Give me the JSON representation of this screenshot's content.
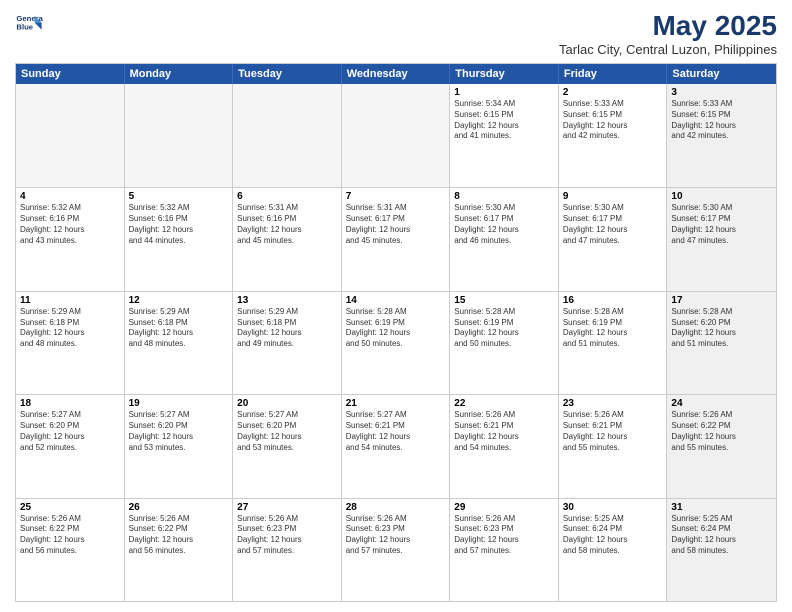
{
  "logo": {
    "line1": "General",
    "line2": "Blue"
  },
  "title": "May 2025",
  "location": "Tarlac City, Central Luzon, Philippines",
  "days": [
    "Sunday",
    "Monday",
    "Tuesday",
    "Wednesday",
    "Thursday",
    "Friday",
    "Saturday"
  ],
  "weeks": [
    [
      {
        "day": "",
        "info": "",
        "empty": true
      },
      {
        "day": "",
        "info": "",
        "empty": true
      },
      {
        "day": "",
        "info": "",
        "empty": true
      },
      {
        "day": "",
        "info": "",
        "empty": true
      },
      {
        "day": "1",
        "info": "Sunrise: 5:34 AM\nSunset: 6:15 PM\nDaylight: 12 hours\nand 41 minutes."
      },
      {
        "day": "2",
        "info": "Sunrise: 5:33 AM\nSunset: 6:15 PM\nDaylight: 12 hours\nand 42 minutes."
      },
      {
        "day": "3",
        "info": "Sunrise: 5:33 AM\nSunset: 6:15 PM\nDaylight: 12 hours\nand 42 minutes.",
        "shaded": true
      }
    ],
    [
      {
        "day": "4",
        "info": "Sunrise: 5:32 AM\nSunset: 6:16 PM\nDaylight: 12 hours\nand 43 minutes."
      },
      {
        "day": "5",
        "info": "Sunrise: 5:32 AM\nSunset: 6:16 PM\nDaylight: 12 hours\nand 44 minutes."
      },
      {
        "day": "6",
        "info": "Sunrise: 5:31 AM\nSunset: 6:16 PM\nDaylight: 12 hours\nand 45 minutes."
      },
      {
        "day": "7",
        "info": "Sunrise: 5:31 AM\nSunset: 6:17 PM\nDaylight: 12 hours\nand 45 minutes."
      },
      {
        "day": "8",
        "info": "Sunrise: 5:30 AM\nSunset: 6:17 PM\nDaylight: 12 hours\nand 46 minutes."
      },
      {
        "day": "9",
        "info": "Sunrise: 5:30 AM\nSunset: 6:17 PM\nDaylight: 12 hours\nand 47 minutes."
      },
      {
        "day": "10",
        "info": "Sunrise: 5:30 AM\nSunset: 6:17 PM\nDaylight: 12 hours\nand 47 minutes.",
        "shaded": true
      }
    ],
    [
      {
        "day": "11",
        "info": "Sunrise: 5:29 AM\nSunset: 6:18 PM\nDaylight: 12 hours\nand 48 minutes."
      },
      {
        "day": "12",
        "info": "Sunrise: 5:29 AM\nSunset: 6:18 PM\nDaylight: 12 hours\nand 48 minutes."
      },
      {
        "day": "13",
        "info": "Sunrise: 5:29 AM\nSunset: 6:18 PM\nDaylight: 12 hours\nand 49 minutes."
      },
      {
        "day": "14",
        "info": "Sunrise: 5:28 AM\nSunset: 6:19 PM\nDaylight: 12 hours\nand 50 minutes."
      },
      {
        "day": "15",
        "info": "Sunrise: 5:28 AM\nSunset: 6:19 PM\nDaylight: 12 hours\nand 50 minutes."
      },
      {
        "day": "16",
        "info": "Sunrise: 5:28 AM\nSunset: 6:19 PM\nDaylight: 12 hours\nand 51 minutes."
      },
      {
        "day": "17",
        "info": "Sunrise: 5:28 AM\nSunset: 6:20 PM\nDaylight: 12 hours\nand 51 minutes.",
        "shaded": true
      }
    ],
    [
      {
        "day": "18",
        "info": "Sunrise: 5:27 AM\nSunset: 6:20 PM\nDaylight: 12 hours\nand 52 minutes."
      },
      {
        "day": "19",
        "info": "Sunrise: 5:27 AM\nSunset: 6:20 PM\nDaylight: 12 hours\nand 53 minutes."
      },
      {
        "day": "20",
        "info": "Sunrise: 5:27 AM\nSunset: 6:20 PM\nDaylight: 12 hours\nand 53 minutes."
      },
      {
        "day": "21",
        "info": "Sunrise: 5:27 AM\nSunset: 6:21 PM\nDaylight: 12 hours\nand 54 minutes."
      },
      {
        "day": "22",
        "info": "Sunrise: 5:26 AM\nSunset: 6:21 PM\nDaylight: 12 hours\nand 54 minutes."
      },
      {
        "day": "23",
        "info": "Sunrise: 5:26 AM\nSunset: 6:21 PM\nDaylight: 12 hours\nand 55 minutes."
      },
      {
        "day": "24",
        "info": "Sunrise: 5:26 AM\nSunset: 6:22 PM\nDaylight: 12 hours\nand 55 minutes.",
        "shaded": true
      }
    ],
    [
      {
        "day": "25",
        "info": "Sunrise: 5:26 AM\nSunset: 6:22 PM\nDaylight: 12 hours\nand 56 minutes."
      },
      {
        "day": "26",
        "info": "Sunrise: 5:26 AM\nSunset: 6:22 PM\nDaylight: 12 hours\nand 56 minutes."
      },
      {
        "day": "27",
        "info": "Sunrise: 5:26 AM\nSunset: 6:23 PM\nDaylight: 12 hours\nand 57 minutes."
      },
      {
        "day": "28",
        "info": "Sunrise: 5:26 AM\nSunset: 6:23 PM\nDaylight: 12 hours\nand 57 minutes."
      },
      {
        "day": "29",
        "info": "Sunrise: 5:26 AM\nSunset: 6:23 PM\nDaylight: 12 hours\nand 57 minutes."
      },
      {
        "day": "30",
        "info": "Sunrise: 5:25 AM\nSunset: 6:24 PM\nDaylight: 12 hours\nand 58 minutes."
      },
      {
        "day": "31",
        "info": "Sunrise: 5:25 AM\nSunset: 6:24 PM\nDaylight: 12 hours\nand 58 minutes.",
        "shaded": true
      }
    ]
  ]
}
